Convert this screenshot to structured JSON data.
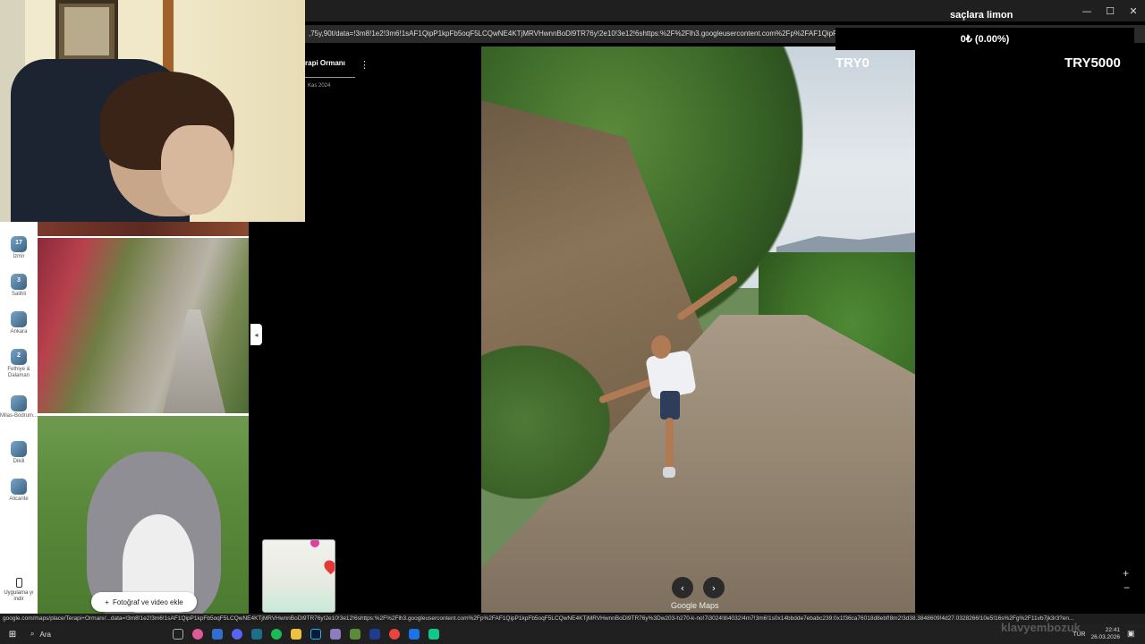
{
  "overlay": {
    "title": "saçlara limon",
    "balance": "0₺ (0.00%)",
    "try_left": "TRY0",
    "try_right": "TRY5000"
  },
  "browser": {
    "url_fragment": ",75y,90t/data=!3m8!1e2!3m6!1sAF1QipP1kpFb5oqF5LCQwNE4KTjMRVHwnnBoDl9TR76y!2e10!3e12!6shttps:%2F%2Flh3.googleusercontent.com%2Fp%2FAF1QipP1kp",
    "window_controls": [
      "—",
      "☐",
      "✕"
    ]
  },
  "photo_panel": {
    "place_name": "rapi Ormanı",
    "date": "Kas 2024",
    "menu_icon": "⋮"
  },
  "sidebar": {
    "items": [
      {
        "num": "17",
        "label": "İzmir"
      },
      {
        "num": "3",
        "label": "Salihli"
      },
      {
        "num": "",
        "label": "Ankara"
      },
      {
        "num": "2",
        "label": "Fethiye & Dalaman"
      },
      {
        "num": "",
        "label": "Milas-Bodrum..."
      },
      {
        "num": "",
        "label": "Dikili"
      },
      {
        "num": "",
        "label": "Alicante"
      }
    ],
    "bottom_label": "Uygulama yı indir"
  },
  "photo_column": {
    "add_button": "Fotoğraf ve video ekle",
    "collapse_icon": "◂"
  },
  "viewer": {
    "prev_icon": "‹",
    "next_icon": "›",
    "watermark": "Google Maps",
    "zoom_in": "+",
    "zoom_out": "−"
  },
  "status_url": "google.com/maps/place/Terapi+Ormanı/...data=!3m8!1e2!3m6!1sAF1QipP1kpFb5oqF5LCQwNE4KTjMRVHwnnBoDl9TR76y!2e10!3e12!6shttps:%2F%2Flh3.googleusercontent.com%2Fp%2FAF1QipP1kpFb5oqF5LCQwNE4KTjMRVHwnnBoDl9TR76y%3Dw203-h270-k-no!7i3024!8i4032!4m7!3m6!1s0x14bbdde7ebabc239:0x1f36ca76018d8ebf!8m2!3d38.3848609!4d27.0328266!10e5!16s%2Fg%2F11vb7jk3r3?en...",
  "taskbar": {
    "start": "⊞",
    "search": "Ara",
    "time": "22:41",
    "date": "26.03.2026",
    "lang": "TUR"
  },
  "stream_watermark": "klavyembozuk",
  "colors": {
    "maps_bg": "#ffffff",
    "viewer_bg": "#000000",
    "taskbar_bg": "#202020"
  }
}
